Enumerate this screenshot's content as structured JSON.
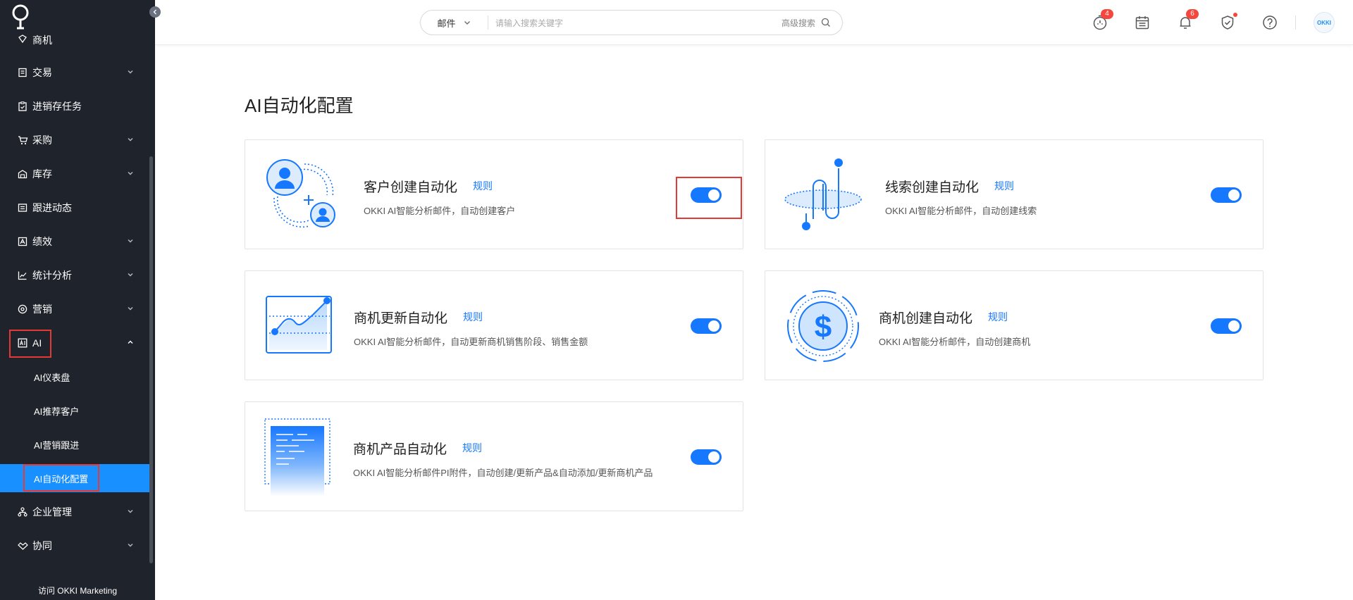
{
  "sidebar": {
    "partial_item": "商机",
    "items": [
      {
        "label": "交易"
      },
      {
        "label": "进销存任务"
      },
      {
        "label": "采购"
      },
      {
        "label": "库存"
      },
      {
        "label": "跟进动态"
      },
      {
        "label": "绩效"
      },
      {
        "label": "统计分析"
      },
      {
        "label": "营销"
      },
      {
        "label": "AI"
      },
      {
        "label": "企业管理"
      },
      {
        "label": "协同"
      }
    ],
    "ai_sub": [
      {
        "label": "AI仪表盘"
      },
      {
        "label": "AI推荐客户"
      },
      {
        "label": "AI营销跟进"
      },
      {
        "label": "AI自动化配置"
      }
    ],
    "visit_label": "访问 OKKI Marketing"
  },
  "header": {
    "search_scope": "邮件",
    "search_placeholder": "请输入搜索关键字",
    "advanced_search": "高级搜索",
    "badges": {
      "timer": "4",
      "notifications": "6"
    },
    "avatar_text": "OKKI"
  },
  "main": {
    "title": "AI自动化配置",
    "rule_label": "规则",
    "cards": [
      {
        "title": "客户创建自动化",
        "desc": "OKKI AI智能分析邮件，自动创建客户",
        "enabled": true
      },
      {
        "title": "线索创建自动化",
        "desc": "OKKI AI智能分析邮件，自动创建线索",
        "enabled": true
      },
      {
        "title": "商机更新自动化",
        "desc": "OKKI AI智能分析邮件，自动更新商机销售阶段、销售金额",
        "enabled": true
      },
      {
        "title": "商机创建自动化",
        "desc": "OKKI AI智能分析邮件，自动创建商机",
        "enabled": true
      },
      {
        "title": "商机产品自动化",
        "desc": "OKKI AI智能分析邮件PI附件，自动创建/更新产品&自动添加/更新商机产品",
        "enabled": true
      }
    ]
  },
  "colors": {
    "accent": "#1677ff",
    "sidebar_bg": "#1f232b",
    "highlight": "#e53935"
  }
}
